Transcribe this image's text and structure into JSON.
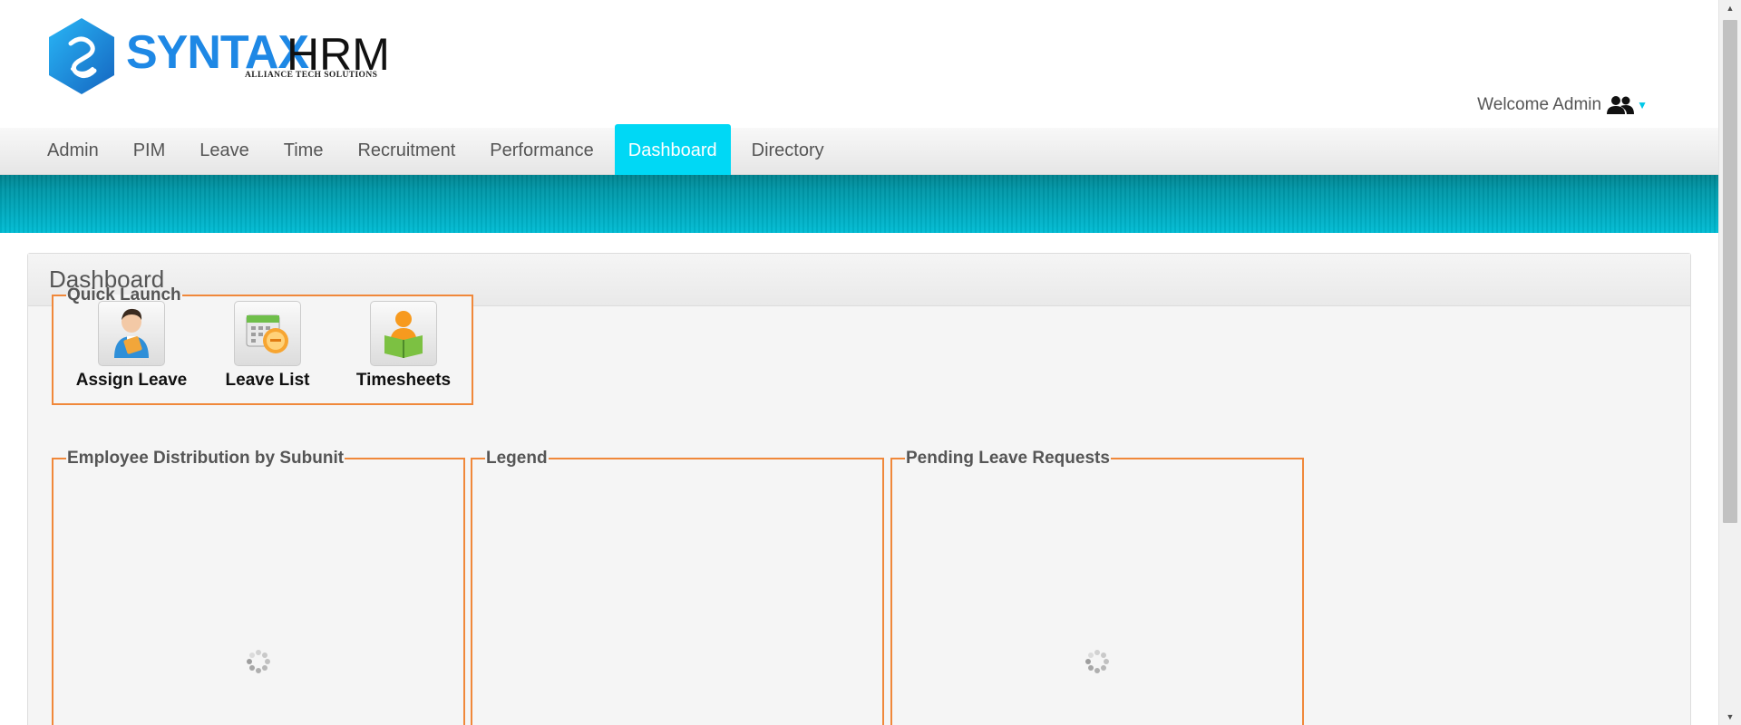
{
  "brand": {
    "logo_primary": "SYNTAX",
    "logo_secondary": "HRM",
    "logo_tagline": "ALLIANCE TECH SOLUTIONS",
    "logo_color": "#1e88e5"
  },
  "user": {
    "welcome_text": "Welcome Admin",
    "icon": "users-icon"
  },
  "menu": {
    "items": [
      {
        "label": "Admin"
      },
      {
        "label": "PIM"
      },
      {
        "label": "Leave"
      },
      {
        "label": "Time"
      },
      {
        "label": "Recruitment"
      },
      {
        "label": "Performance"
      },
      {
        "label": "Dashboard",
        "active": true
      },
      {
        "label": "Directory"
      }
    ],
    "active_color": "#00d8f5"
  },
  "dashboard": {
    "title": "Dashboard",
    "quick_launch": {
      "legend": "Quick Launch",
      "items": [
        {
          "label": "Assign Leave",
          "icon": "assign-leave-icon"
        },
        {
          "label": "Leave List",
          "icon": "leave-list-icon"
        },
        {
          "label": "Timesheets",
          "icon": "timesheets-icon"
        }
      ]
    },
    "widgets": {
      "employee_distribution": "Employee Distribution by Subunit",
      "legend": "Legend",
      "pending_leave": "Pending Leave Requests"
    },
    "box_border_color": "#f0883a"
  }
}
